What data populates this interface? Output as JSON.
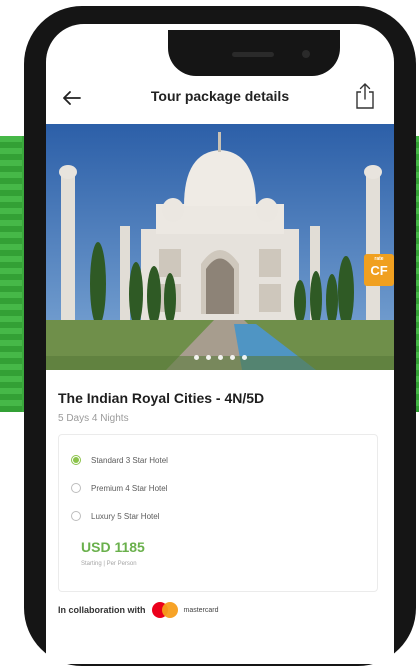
{
  "header": {
    "title": "Tour package details"
  },
  "icons": {
    "back": "arrow-left-icon",
    "share": "share-icon"
  },
  "hero": {
    "dots": 5,
    "badge_small": "rate",
    "badge_big": "CF"
  },
  "package": {
    "title": "The Indian Royal Cities - 4N/5D",
    "subtitle": "5 Days 4 Nights",
    "options": [
      {
        "label": "Standard 3 Star Hotel",
        "selected": true
      },
      {
        "label": "Premium 4 Star Hotel",
        "selected": false
      },
      {
        "label": "Luxury 5 Star Hotel",
        "selected": false
      }
    ],
    "price": "USD 1185",
    "price_note": "Starting | Per Person"
  },
  "collab": {
    "text": "In collaboration with",
    "brand": "mastercard"
  },
  "colors": {
    "accent_green": "#6ab04c",
    "radio_green": "#8bc34a",
    "band_green": "#3aa83c",
    "badge_orange": "#f0a020"
  }
}
